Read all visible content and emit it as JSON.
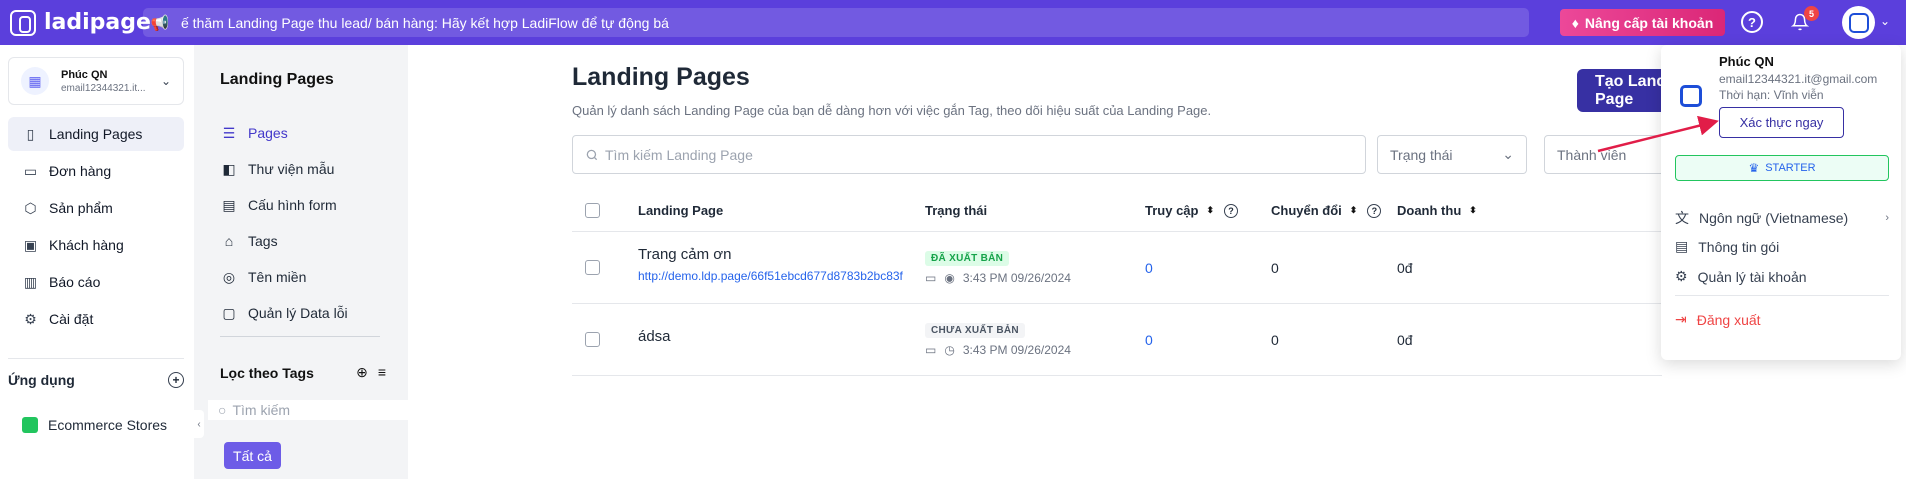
{
  "brand": {
    "name": "ladipage"
  },
  "topbar": {
    "ticker_text": "ế thăm Landing Page thu lead/ bán hàng: Hãy kết hợp LadiFlow để tự động bá",
    "upgrade_label": "Nâng cấp tài khoản",
    "notification_count": "5",
    "help_glyph": "?"
  },
  "workspace": {
    "name": "Phúc QN",
    "email": "email12344321.it..."
  },
  "sidebar": {
    "items": [
      {
        "label": "Landing Pages",
        "icon": "landing-pages-icon"
      },
      {
        "label": "Đơn hàng",
        "icon": "orders-icon"
      },
      {
        "label": "Sản phẩm",
        "icon": "products-icon"
      },
      {
        "label": "Khách hàng",
        "icon": "customers-icon"
      },
      {
        "label": "Báo cáo",
        "icon": "reports-icon"
      },
      {
        "label": "Cài đặt",
        "icon": "settings-icon"
      }
    ],
    "apps_title": "Ứng dụng",
    "apps": [
      {
        "label": "Ecommerce Stores",
        "icon": "store-icon"
      }
    ]
  },
  "subnav": {
    "title": "Landing Pages",
    "items": [
      {
        "label": "Pages"
      },
      {
        "label": "Thư viện mẫu"
      },
      {
        "label": "Cấu hình form"
      },
      {
        "label": "Tags"
      },
      {
        "label": "Tên miền"
      },
      {
        "label": "Quản lý Data lỗi"
      }
    ],
    "tags_title": "Lọc theo Tags",
    "tags_search_placeholder": "Tìm kiếm",
    "all_label": "Tất cả"
  },
  "main": {
    "title": "Landing Pages",
    "subtitle": "Quản lý danh sách Landing Page của bạn dễ dàng hơn với việc gắn Tag, theo dõi hiệu suất của Landing Page.",
    "create_label": "Tạo Landing Page",
    "search_placeholder": "Tìm kiếm Landing Page",
    "status_filter": "Trạng thái",
    "member_filter": "Thành viên",
    "columns": {
      "page": "Landing Page",
      "status": "Trạng thái",
      "visits": "Truy cập",
      "conversions": "Chuyển đổi",
      "revenue": "Doanh thu"
    },
    "rows": [
      {
        "name": "Trang cảm ơn",
        "url": "http://demo.ldp.page/66f51ebcd677d8783b2bc83f",
        "status": "ĐÃ XUẤT BẢN",
        "time": "3:43 PM 09/26/2024",
        "visits": "0",
        "conversions": "0",
        "revenue": "0đ"
      },
      {
        "name": "ádsa",
        "url": "",
        "status": "CHƯA XUẤT BẢN",
        "time": "3:43 PM 09/26/2024",
        "visits": "0",
        "conversions": "0",
        "revenue": "0đ"
      }
    ]
  },
  "account_menu": {
    "name": "Phúc QN",
    "email": "email12344321.it@gmail.com",
    "expiry": "Thời hạn: Vĩnh viễn",
    "verify_label": "Xác thực ngay",
    "plan": "STARTER",
    "language": "Ngôn ngữ (Vietnamese)",
    "package_info": "Thông tin gói",
    "manage_account": "Quản lý tài khoản",
    "logout": "Đăng xuất"
  },
  "colors": {
    "brand": "#5b3fdc",
    "accent": "#3730a3",
    "upgrade": "#ec4899",
    "link": "#2563eb",
    "danger": "#ef4444",
    "success": "#22c55e"
  }
}
